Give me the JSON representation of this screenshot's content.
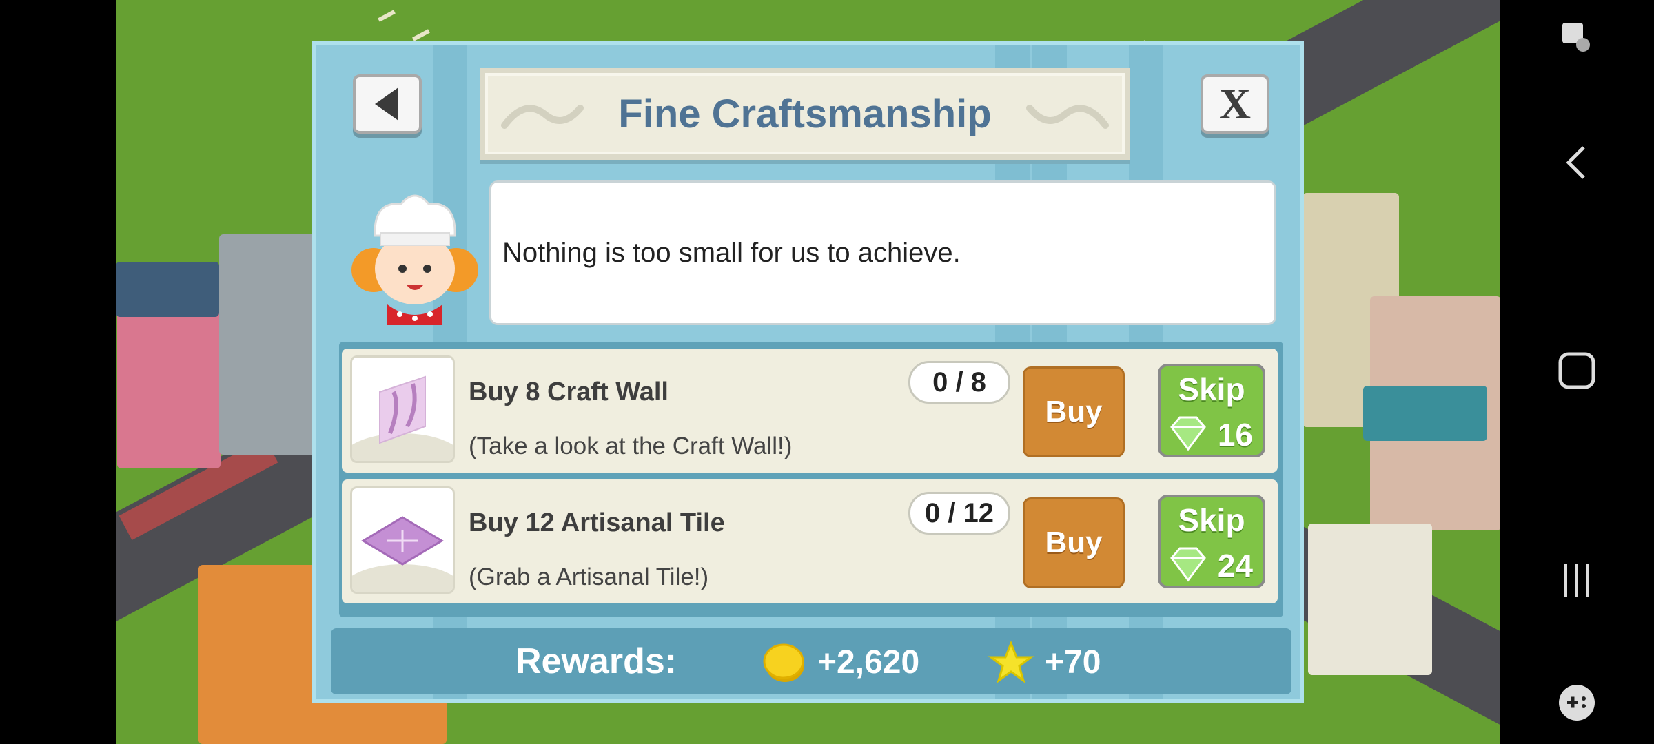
{
  "dialog": {
    "title": "Fine Craftsmanship",
    "close_label": "X",
    "message": "Nothing is too small for us to achieve."
  },
  "tasks": [
    {
      "title": "Buy 8 Craft Wall",
      "hint": "(Take a look at the Craft Wall!)",
      "progress": "0 / 8",
      "buy_label": "Buy",
      "skip_label": "Skip",
      "skip_cost": "16",
      "thumb_icon": "craft-wall-icon"
    },
    {
      "title": "Buy 12 Artisanal Tile",
      "hint": "(Grab a Artisanal Tile!)",
      "progress": "0 / 12",
      "buy_label": "Buy",
      "skip_label": "Skip",
      "skip_cost": "24",
      "thumb_icon": "artisanal-tile-icon"
    }
  ],
  "rewards": {
    "label": "Rewards:",
    "coins": "+2,620",
    "stars": "+70"
  },
  "colors": {
    "dialog_bg": "#8fcadc",
    "title_text": "#4f7394",
    "buy_button": "#d28934",
    "skip_button": "#80c446"
  }
}
